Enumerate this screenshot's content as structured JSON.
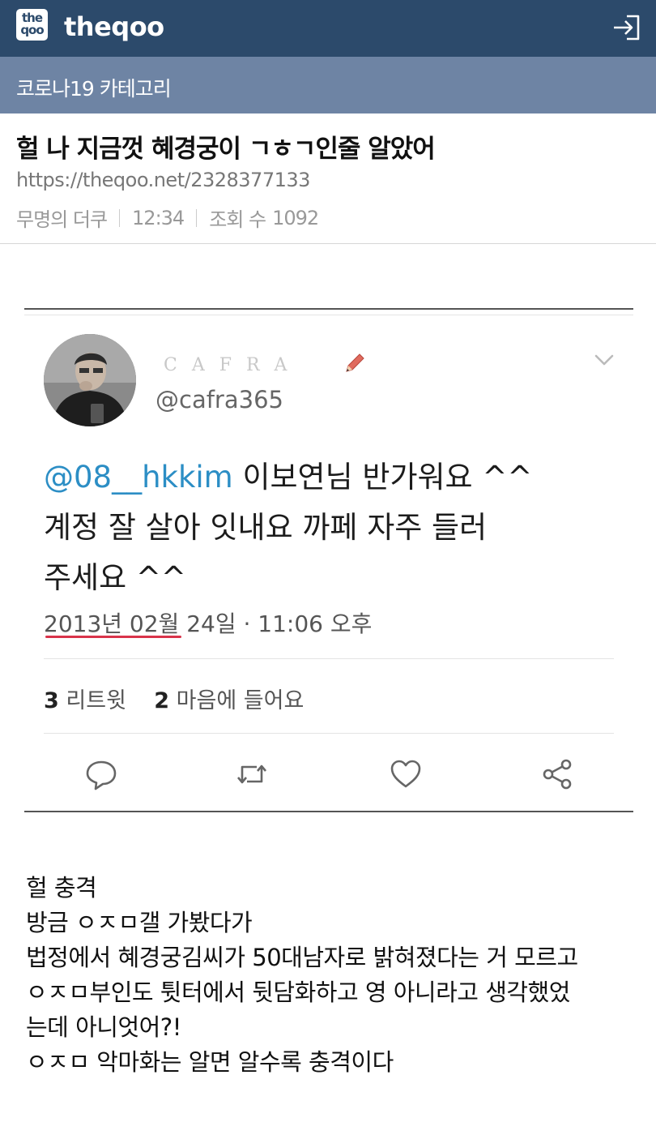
{
  "header": {
    "logo_line1": "the",
    "logo_line2": "qoo",
    "brand": "theqoo",
    "brand_color": "#2c4a6b",
    "login_icon": "login-icon"
  },
  "category": {
    "label": "코로나19 카테고리",
    "color": "#6e84a4"
  },
  "post": {
    "title": "헐 나 지금껏 혜경궁이 ㄱㅎㄱ인줄 알았어",
    "url": "https://theqoo.net/2328377133",
    "author": "무명의 더쿠",
    "time": "12:34",
    "views_label": "조회 수",
    "views_count": "1092"
  },
  "tweet": {
    "display_name": "CAFRA",
    "handle": "@cafra365",
    "mention": "@08__hkkim",
    "text_line1_rest": " 이보연님 반가워요 ^^",
    "text_line2": "계정 잘 살아 잇내요 까페 자주 들러",
    "text_line3": "주세요 ^^",
    "date": "2013년 02월 24일 · 11:06 오후",
    "retweets_count": "3",
    "retweets_label": "리트윗",
    "likes_count": "2",
    "likes_label": "마음에 들어요",
    "mention_color": "#2c8ec5",
    "underline_color": "#d9334a"
  },
  "body": {
    "lines": [
      "헐 충격",
      "방금 ㅇㅈㅁ갤 가봤다가",
      "법정에서 혜경궁김씨가 50대남자로 밝혀졌다는 거 모르고",
      "ㅇㅈㅁ부인도 튓터에서 뒷담화하고 영 아니라고 생각했었",
      "는데 아니엇어?!",
      "ㅇㅈㅁ 악마화는 알면 알수록 충격이다"
    ]
  }
}
